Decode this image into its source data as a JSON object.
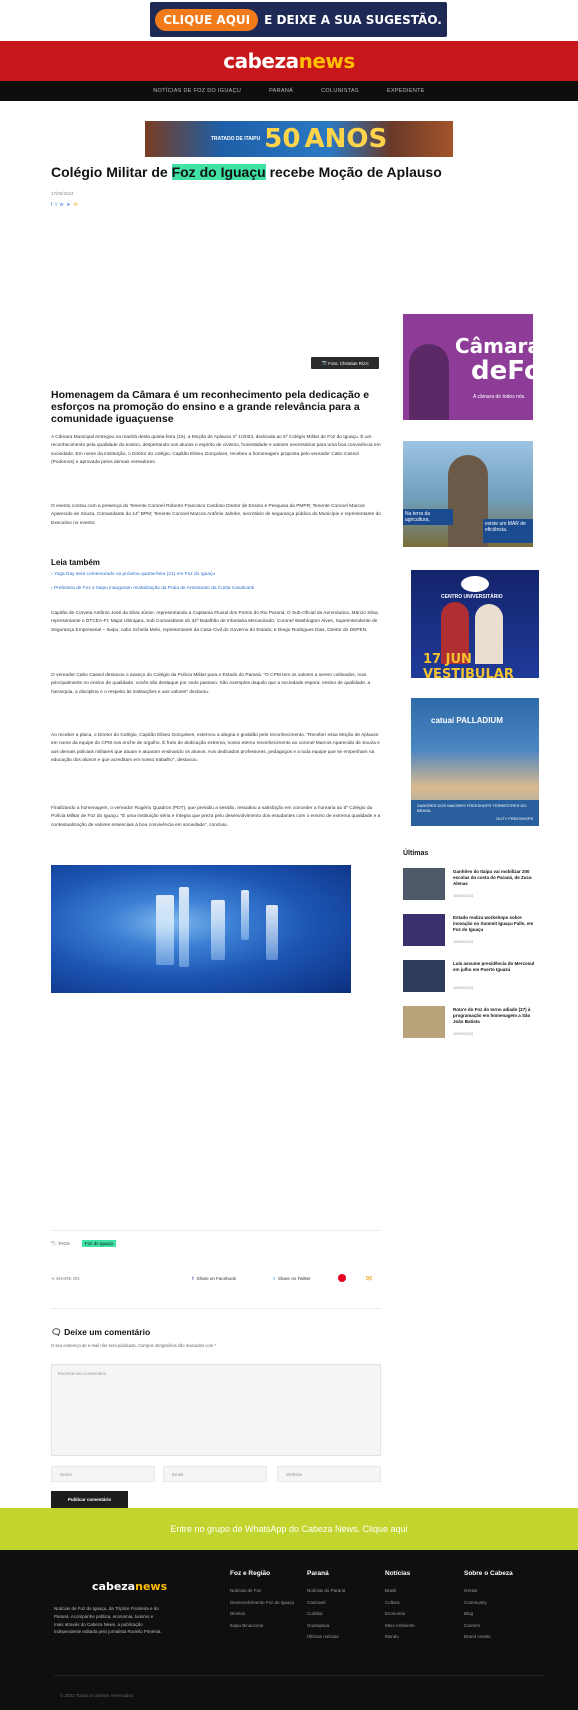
{
  "top_banner": {
    "pill": "CLIQUE AQUI",
    "text": "E DEIXE A SUA SUGESTÃO."
  },
  "header": {
    "logo_left": "cabeza",
    "logo_right": "news"
  },
  "nav": [
    "NOTÍCIAS DE FOZ DO IGUAÇU",
    "PARANÁ",
    "COLUNISTAS",
    "EXPEDIENTE"
  ],
  "top_ad": {
    "number": "50",
    "word": "ANOS",
    "small": "TRATADO DE ITAIPU"
  },
  "article": {
    "title_before": "Colégio Militar de ",
    "title_hl": "Foz do Iguaçu",
    "title_after": " recebe Moção de Aplauso",
    "date": "17/05/2024",
    "image_caption": "Foto: Christian Rizzi",
    "subheading": "Homenagem da Câmara é um reconhecimento pela dedicação e esforços na promoção do ensino e a grande relevância para a comunidade iguaçuense",
    "p1": "A Câmara Municipal entregou na manhã desta quinta-feira (16), a Moção de Aplauso nº 1/2023, dedicada ao 5º Colégio Militar de Foz do Iguaçu. É um reconhecimento pela qualidade do ensino, despertando nos alunos o espírito de civismo, honestidade e valores necessários para uma boa convivência em sociedade. Em nome da instituição, o Diretor do colégio, Capitão Eliseu Gonçalves, recebeu a homenagem proposta pelo vereador Cabo Cassol (Podemos) e aprovada pelos demais vereadores.",
    "p2": "O evento contou com a presença do Tenente Coronel Roberto Francisco Cardoso Diretor de Ensino e Pesquisa da PMPR; Tenente Coronel Marcos Aparecido de Souza, Comandante do 14º BPM; Tenente Coronel Marcos Antônio Jahnke, secretário de segurança pública do Município e representante do Executivo no evento;",
    "leia_title": "Leia também",
    "leia": [
      "Yoga Day será comemorado na próxima quarta-feira (21) em Foz do Iguaçu",
      "Prefeitura de Foz e Itaipu inauguram revitalização da Praia de Artesanato da Costa Cavalcanti"
    ],
    "p3": "Capitão de Corveta Antônio José da Silva Júnior, representando a Capitania Fluvial dos Portos do Rio Paraná; O Sub-Oficial da Aeronáutica, Márcio Silva, representante o DTCEA-FI; Major Ubirajara, Sub Comandante do 34º Batalhão de Infantaria Mecanizado; Coronel Washington Alves, Superintendente de Segurança Empresarial – Itaipu; cabo Scheila Melo, representante da Casa Civil do Governo do Estado; e Diego Rodrigues Dias, Diretor do DEPEN.",
    "p4": "O vereador Cabo Cassol destacou o avanço do Colégio da Polícia Militar para o Estado do Paraná. “O CPM tem os valores a serem cultivados, mas principalmente no ensino de qualidade, vocês são destaque por onde passam. São exemplos daquilo que a sociedade espera: ensino de qualidade, a hierarquia, a disciplina e o respeito às instituições e aos valores” declarou.",
    "p5": "Ao receber a placa, o Diretor do Colégio, Capitão Eliseu Gonçalves, externou a alegria e gratidão pelo reconhecimento. “Receber essa Moção de Aplauso em nome da equipe do CPM nos enche de orgulho. É fruto de dedicação extrema, nosso eterno reconhecimento ao coronel Marcos Aparecido de Souza e aos demais policiais militares que atuam e atuaram ensinando os alunos. Aos dedicados professores, pedagogos e a toda equipe que se empenham na educação dos alunos e que acreditam em nosso trabalho”, destacou.",
    "p6": "Finalizando a homenagem, o vereador Rogério Quadros (PDT), que presidiu a sessão, ressaltou a satisfação em conceder a honraria ao 5º Colégio da Polícia Militar de Foz do Iguaçu. “É uma instituição séria e íntegra que preza pelo desenvolvimento dos estudantes com o ensino de extrema qualidade e a contextualização de valores essenciais à boa convivência em sociedade”, concluiu."
  },
  "sidebar_ads": {
    "camara": {
      "line1": "Câmara",
      "line2": "deFoz",
      "tagline": "A câmara de todos nós."
    },
    "agri": {
      "box1": "Na terra da agricultura,",
      "box2": "existe um MAR de eficiência."
    },
    "ubc": {
      "title": "CENTRO UNIVERSITÁRIO",
      "date": "17 JUN VESTIBULAR"
    },
    "catuai": {
      "logo": "catuaí PALLADIUM",
      "bottom": "SABORES DOS MAIORES FREESHOPS TERRESTRES DO BRASIL",
      "tag": "DUTY FREESHOPS"
    }
  },
  "ultimas": {
    "title": "Últimas",
    "items": [
      {
        "title": "Ganhões do Itaipu vai mobilizar 200 escolas da costa do Paraná, de Zuca Alenas",
        "date": "15/05/2024"
      },
      {
        "title": "Estado realiza workshops sobre inovação no Summit Iguaçu Falls, em Foz do Iguaçu",
        "date": "15/05/2024"
      },
      {
        "title": "Lula assume presidência do Mercosul em julho em Puerto Iguazú",
        "date": "15/05/2024"
      },
      {
        "title": "Rota'e do Foz do Iorno adiado (27) à programação em homenagem a São João Batista",
        "date": "15/05/2024"
      }
    ]
  },
  "tags": {
    "label": "TAGS",
    "tag": "Foz do Iguaçu"
  },
  "share": {
    "label": "SHARE ON",
    "facebook": "Share on Facebook",
    "twitter": "Share on Twitter"
  },
  "comment": {
    "heading": "Deixe um comentário",
    "note": "O seu endereço de e-mail não será publicado. Campos obrigatórios são marcados com *",
    "placeholder": "Escreva seu comentário",
    "name": "Nome",
    "email": "Email",
    "website": "Website",
    "button": "Publicar comentário"
  },
  "whatsapp": "Entre no grupo de WhatsApp do Cabeza News. Clique aqui",
  "footer": {
    "logo_left": "cabeza",
    "logo_right": "news",
    "desc": "Notícias de Foz do Iguaçu, da Tríplice Fronteira e do Paraná. Acompanhe política, economia, turismo e mais através do Cabeza News, a publicação independente editada pelo jornalista Ruviélo Pimenta.",
    "columns": [
      {
        "title": "Foz e Região",
        "items": [
          "Notícias de Foz",
          "Desenvolvimento Foz do Iguaçu",
          "Direitos",
          "Itaipu Binacional"
        ]
      },
      {
        "title": "Paraná",
        "items": [
          "Notícias do Paraná",
          "Cascavel",
          "Curitiba",
          "Guarapava",
          "Últimas notícias"
        ]
      },
      {
        "title": "Notícias",
        "items": [
          "Brasil",
          "Cultura",
          "Economia",
          "Meio Ambiente",
          "Mundo"
        ]
      },
      {
        "title": "Sobre o Cabeza",
        "items": [
          "Gerais",
          "Community",
          "Blog",
          "Careers",
          "Brand Assets"
        ]
      }
    ],
    "copyright": "© 2022 Todos os direitos reservados"
  },
  "colors": {
    "red": "#c8171a",
    "highlight": "#3fe2a4",
    "whatsapp_bar": "#c2d52e"
  }
}
